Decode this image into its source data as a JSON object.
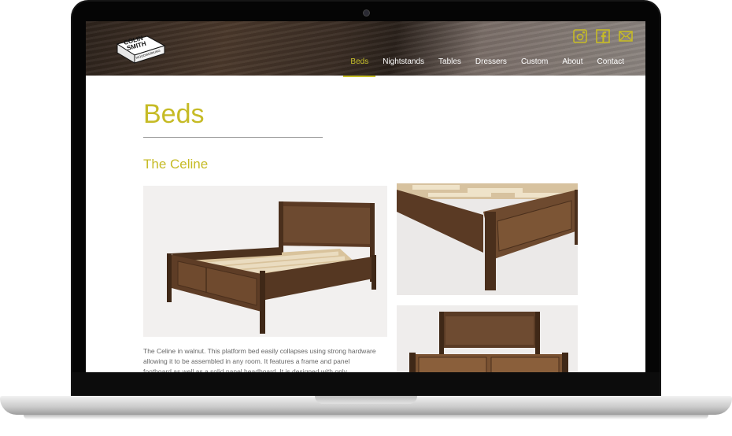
{
  "brand": {
    "logo_lines": [
      "COLIN",
      "SMITH",
      "WOODWORKING"
    ]
  },
  "nav": {
    "items": [
      {
        "label": "Beds",
        "active": true
      },
      {
        "label": "Nightstands",
        "active": false
      },
      {
        "label": "Tables",
        "active": false
      },
      {
        "label": "Dressers",
        "active": false
      },
      {
        "label": "Custom",
        "active": false
      },
      {
        "label": "About",
        "active": false
      },
      {
        "label": "Contact",
        "active": false
      }
    ],
    "social": [
      "instagram-icon",
      "facebook-icon",
      "mail-icon"
    ]
  },
  "page": {
    "title": "Beds",
    "product_title": "The Celine",
    "description": "The Celine in walnut. This platform bed easily collapses using strong hardware allowing it to be assembled in any room. It features a frame and panel footboard as well as a solid panel headboard. It is designed with only"
  },
  "colors": {
    "accent": "#c6bb26",
    "wood": "#5a3b25",
    "slat": "#e9d9b9"
  }
}
